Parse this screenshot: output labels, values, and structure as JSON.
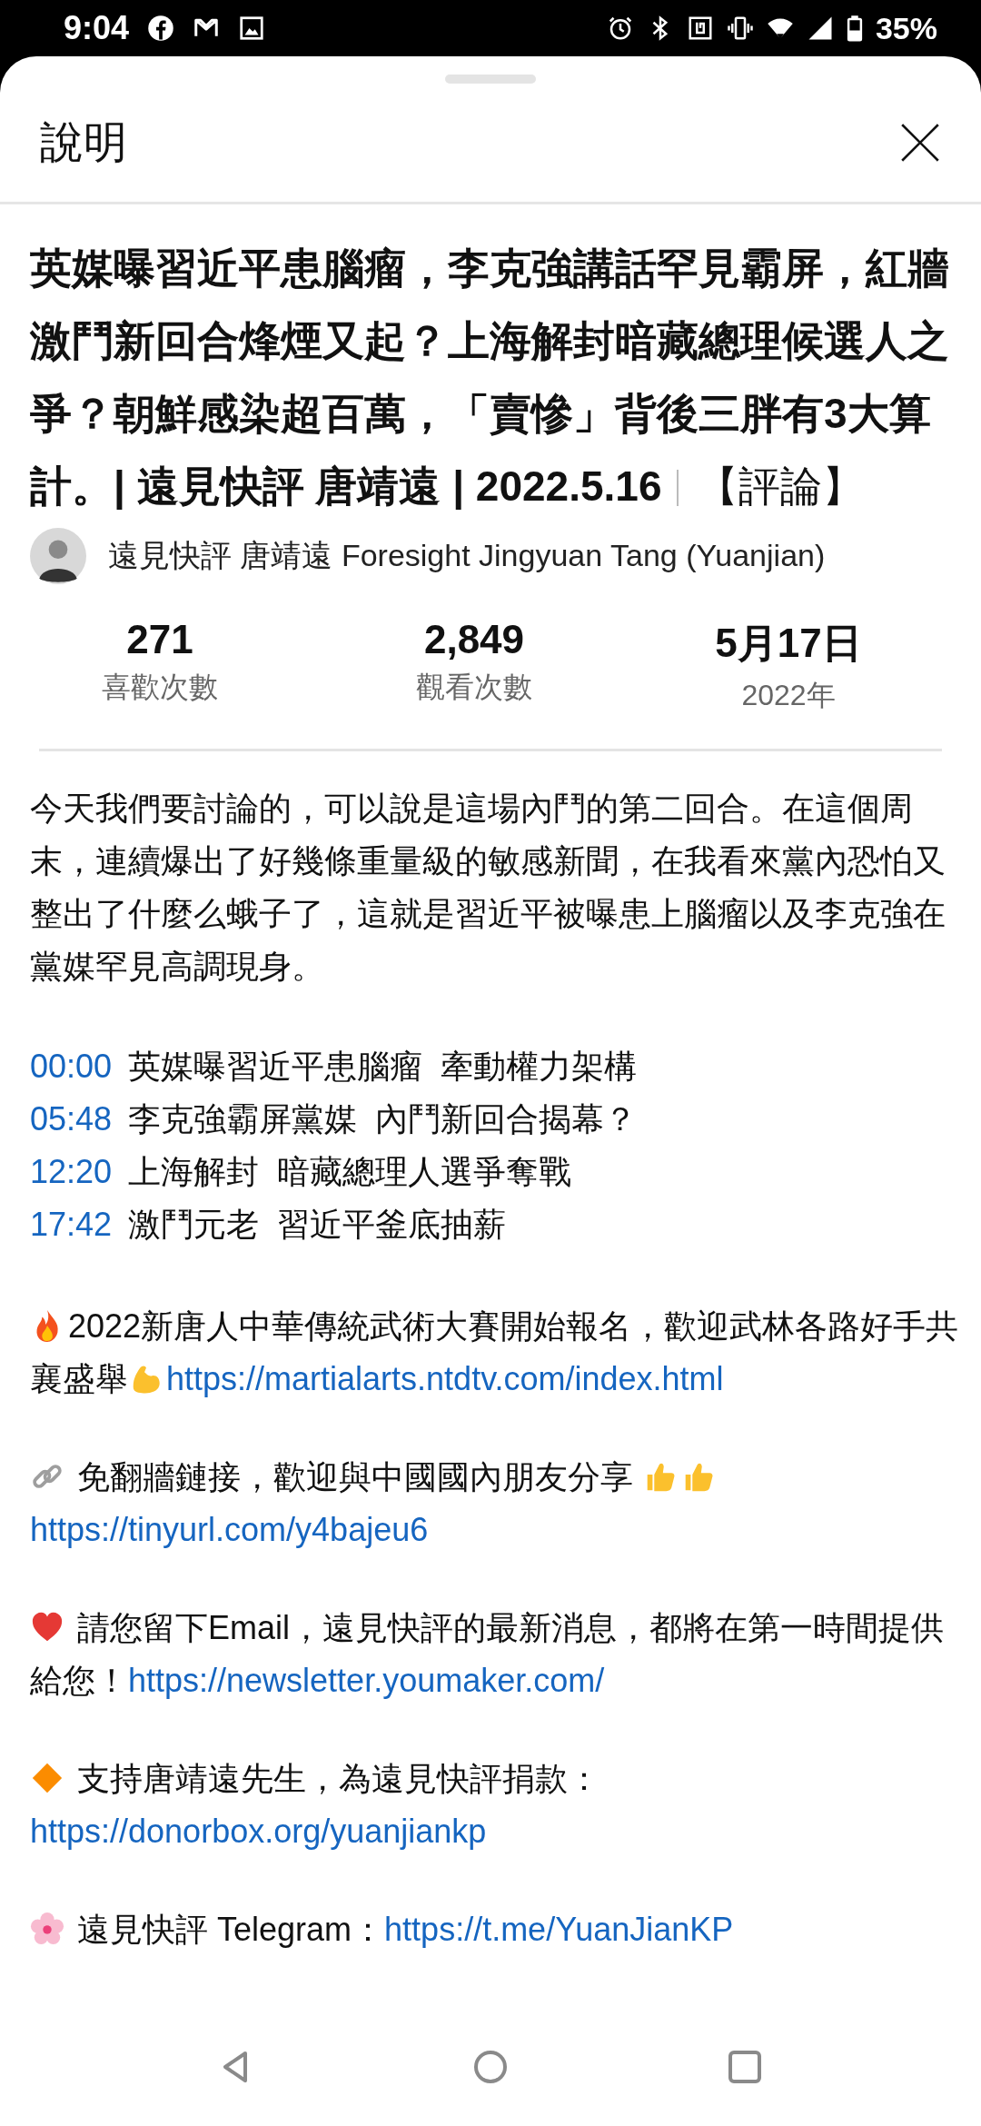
{
  "status_bar": {
    "time": "9:04",
    "battery": "35%"
  },
  "sheet": {
    "title": "說明"
  },
  "video": {
    "title": "英媒曝習近平患腦瘤，李克強講話罕見霸屏，紅牆激鬥新回合烽煙又起？上海解封暗藏總理候選人之爭？朝鮮感染超百萬，「賣慘」背後三胖有3大算計。| 遠見快評 唐靖遠 | 2022.5.16",
    "tag": "【評論】"
  },
  "channel": {
    "name": "遠見快評 唐靖遠 Foresight Jingyuan Tang (Yuanjian)"
  },
  "stats": [
    {
      "value": "271",
      "label": "喜歡次數"
    },
    {
      "value": "2,849",
      "label": "觀看次數"
    },
    {
      "value": "5月17日",
      "label": "2022年"
    }
  ],
  "description": {
    "intro": "今天我們要討論的，可以說是這場內鬥的第二回合。在這個周末，連續爆出了好幾條重量級的敏感新聞，在我看來黨內恐怕又整出了什麼么蛾子了，這就是習近平被曝患上腦瘤以及李克強在黨媒罕見高調現身。",
    "chapters": [
      {
        "time": "00:00",
        "title": "英媒曝習近平患腦瘤  牽動權力架構"
      },
      {
        "time": "05:48",
        "title": "李克強霸屏黨媒  內鬥新回合揭幕？"
      },
      {
        "time": "12:20",
        "title": "上海解封  暗藏總理人選爭奪戰"
      },
      {
        "time": "17:42",
        "title": "激鬥元老  習近平釜底抽薪"
      }
    ],
    "notes": [
      {
        "kind": "contest",
        "text": "2022新唐人中華傳統武術大賽開始報名，歡迎武林各路好手共襄盛舉",
        "link": "https://martialarts.ntdtv.com/index.html"
      },
      {
        "kind": "share",
        "text": " 免翻牆鏈接，歡迎與中國國內朋友分享 ",
        "link": "https://tinyurl.com/y4bajeu6"
      },
      {
        "kind": "newsletter",
        "text": " 請您留下Email，遠見快評的最新消息，都將在第一時間提供給您！",
        "link": "https://newsletter.youmaker.com/"
      },
      {
        "kind": "donate",
        "text": " 支持唐靖遠先生，為遠見快評捐款：",
        "link": "https://donorbox.org/yuanjiankp"
      },
      {
        "kind": "telegram",
        "text": " 遠見快評 Telegram：",
        "link": "https://t.me/YuanJianKP"
      }
    ]
  }
}
